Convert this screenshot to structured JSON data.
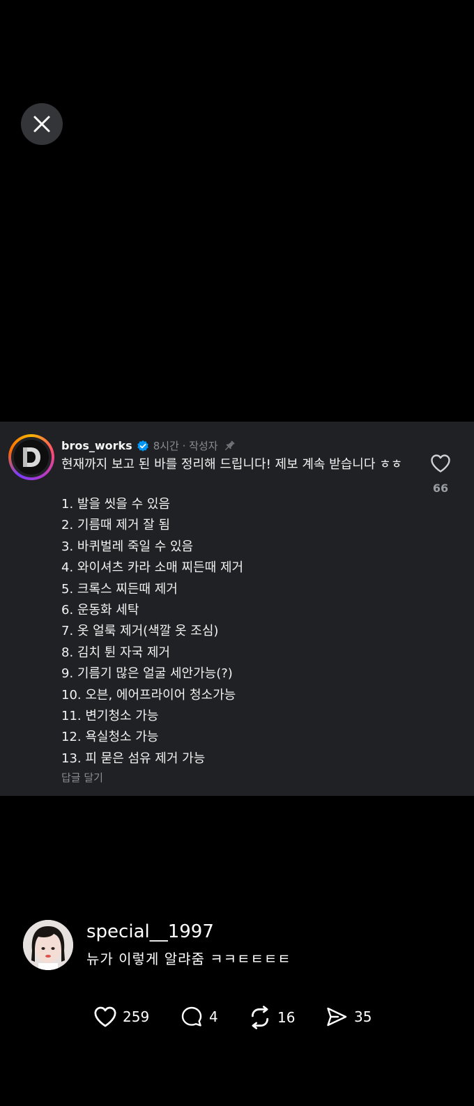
{
  "close_button": {
    "icon": "close-icon"
  },
  "comment": {
    "username": "bros_works",
    "verified_icon": "verified-badge-icon",
    "meta": "8시간 · 작성자",
    "pin_icon": "pin-icon",
    "intro": "현재까지 보고 된 바를 정리해 드립니다! 제보 계속 받습니다 ㅎㅎ",
    "items": [
      "1. 발을 씻을 수 있음",
      "2. 기름때 제거 잘 됨",
      "3. 바퀴벌레 죽일 수 있음",
      "4. 와이셔츠 카라 소매 찌든때 제거",
      "5. 크록스 찌든때 제거",
      "6. 운동화 세탁",
      "7. 옷 얼룩 제거(색깔 옷 조심)",
      "8. 김치 튄 자국 제거",
      "9. 기름기 많은 얼굴 세안가능(?)",
      "10. 오븐, 에어프라이어 청소가능",
      "11. 변기청소 가능",
      "12. 욕실청소 가능",
      "13. 피 묻은 섬유 제거 가능"
    ],
    "reply_label": "답글 달기",
    "like_count": "66"
  },
  "post": {
    "author": "special__1997",
    "caption": "뉴가 이렇게 알랴줌 ㅋㅋㅌㅌㅌㅌ"
  },
  "stats": {
    "likes": "259",
    "comments": "4",
    "reposts": "16",
    "shares": "35"
  },
  "colors": {
    "background": "#000000",
    "card": "#1f2124",
    "muted_text": "#8a8d91",
    "verified": "#0095f6"
  }
}
